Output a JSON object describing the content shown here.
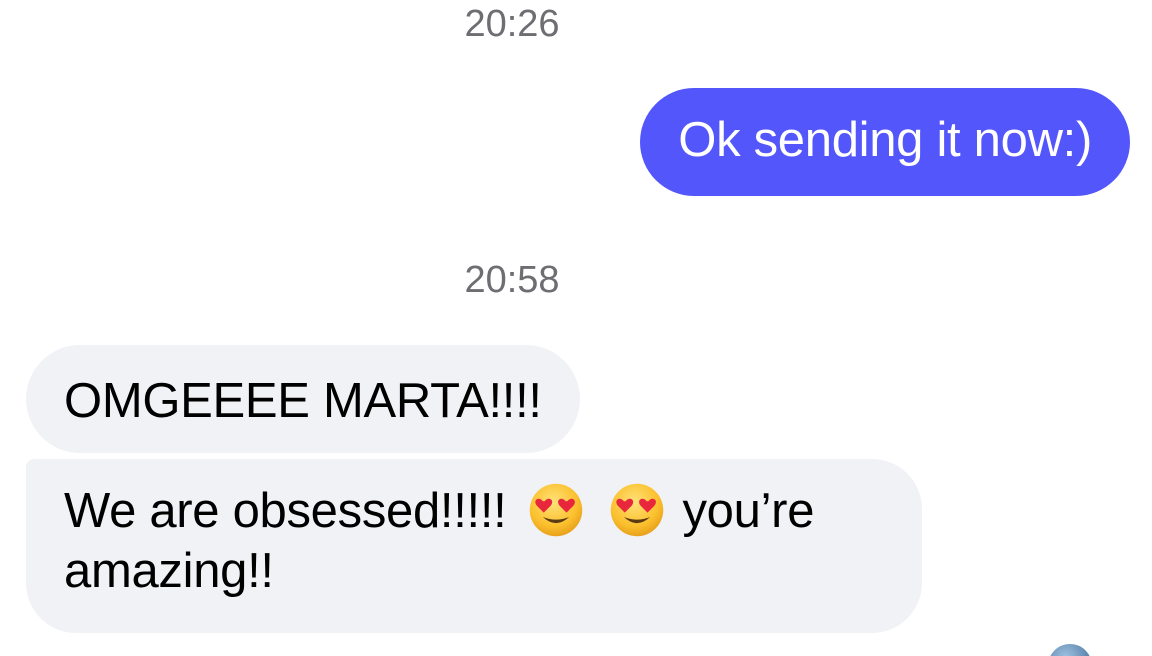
{
  "thread": {
    "messages": [
      {
        "type": "timestamp",
        "text": "20:26"
      },
      {
        "type": "sent",
        "text": "Ok sending it now:)"
      },
      {
        "type": "timestamp",
        "text": "20:58"
      },
      {
        "type": "received",
        "text": "OMGEEEE MARTA!!!!"
      },
      {
        "type": "received",
        "text_before": "We are obsessed!!!!!",
        "emojis": [
          "heart-eyes-emoji",
          "heart-eyes-emoji"
        ],
        "text_after": "you’re amazing!!"
      }
    ]
  },
  "colors": {
    "sent_bubble": "#5356fb",
    "received_bubble": "#f1f2f6",
    "timestamp_text": "#6d6d72"
  }
}
